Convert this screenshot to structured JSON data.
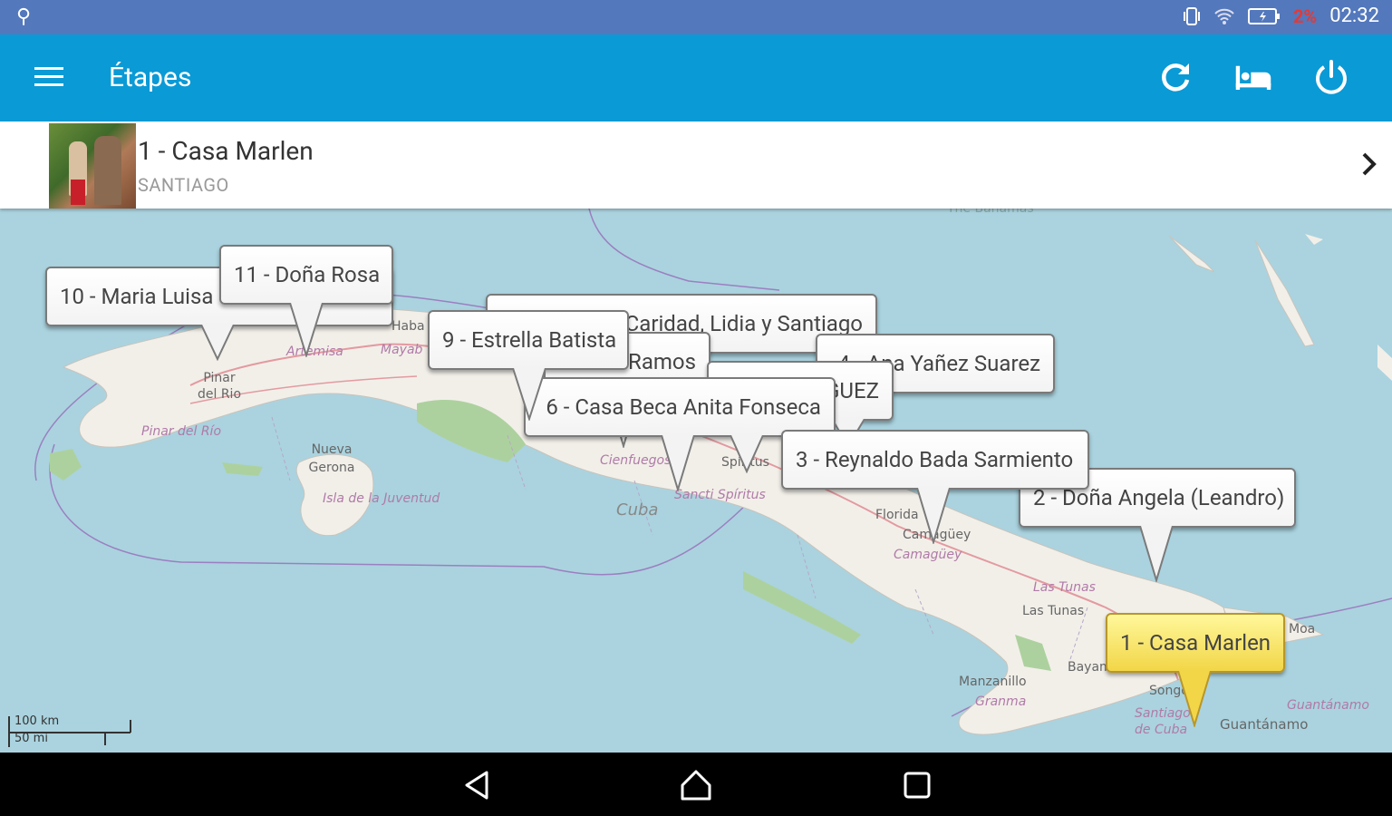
{
  "app": {
    "title": "Étapes"
  },
  "status_bar": {
    "battery": "2%",
    "time": "02:32"
  },
  "current_stage": {
    "title": "1 - Casa Marlen",
    "subtitle": "SANTIAGO"
  },
  "map": {
    "labels": {
      "bahamas": "The Bahamas",
      "pinar_city": "Pinar del Rio",
      "pinar_prov": "Pinar del Río",
      "artemisa": "Artemisa",
      "mayabeque": "Mayab",
      "havana": "Haba",
      "nueva_gerona": "Nueva Gerona",
      "isla": "Isla de la Juventud",
      "cienfuegos": "Cienfuegos",
      "cuba": "Cuba",
      "sancti": "Sancti Spíritus",
      "spiritus": "Spíritus",
      "florida": "Florida",
      "camaguey_city": "Camagüey",
      "camaguey_prov": "Camagüey",
      "las_tunas_prov": "Las Tunas",
      "las_tunas_city": "Las Tunas",
      "moa": "Moa",
      "bayamo": "Bayamo",
      "manzanillo": "Manzanillo",
      "granma": "Granma",
      "songo": "Songo",
      "santiago_prov": "Santiago de Cuba",
      "guantanamo_prov": "Guantánamo",
      "guantanamo_city": "Guantánamo"
    },
    "pins": [
      {
        "id": "10",
        "label": "10 - Maria Luisa"
      },
      {
        "id": "11",
        "label": "11 - Doña Rosa"
      },
      {
        "id": "7",
        "label": "7 - Caridad, Lidia y Santiago"
      },
      {
        "id": "4",
        "label": "4 - Ana Yañez Suarez"
      },
      {
        "id": "8",
        "label": "8 - Ramos"
      },
      {
        "id": "5",
        "label": "5 - RODRIGUEZ"
      },
      {
        "id": "6",
        "label": "6 - Casa Beca Anita Fonseca"
      },
      {
        "id": "9",
        "label": "9 - Estrella Batista"
      },
      {
        "id": "3",
        "label": "3 - Reynaldo Bada Sarmiento"
      },
      {
        "id": "2",
        "label": "2 - Doña Angela (Leandro)"
      },
      {
        "id": "1",
        "label": "1 - Casa Marlen",
        "active": true
      }
    ],
    "scale": {
      "km": "100 km",
      "mi": "50 mi"
    }
  }
}
